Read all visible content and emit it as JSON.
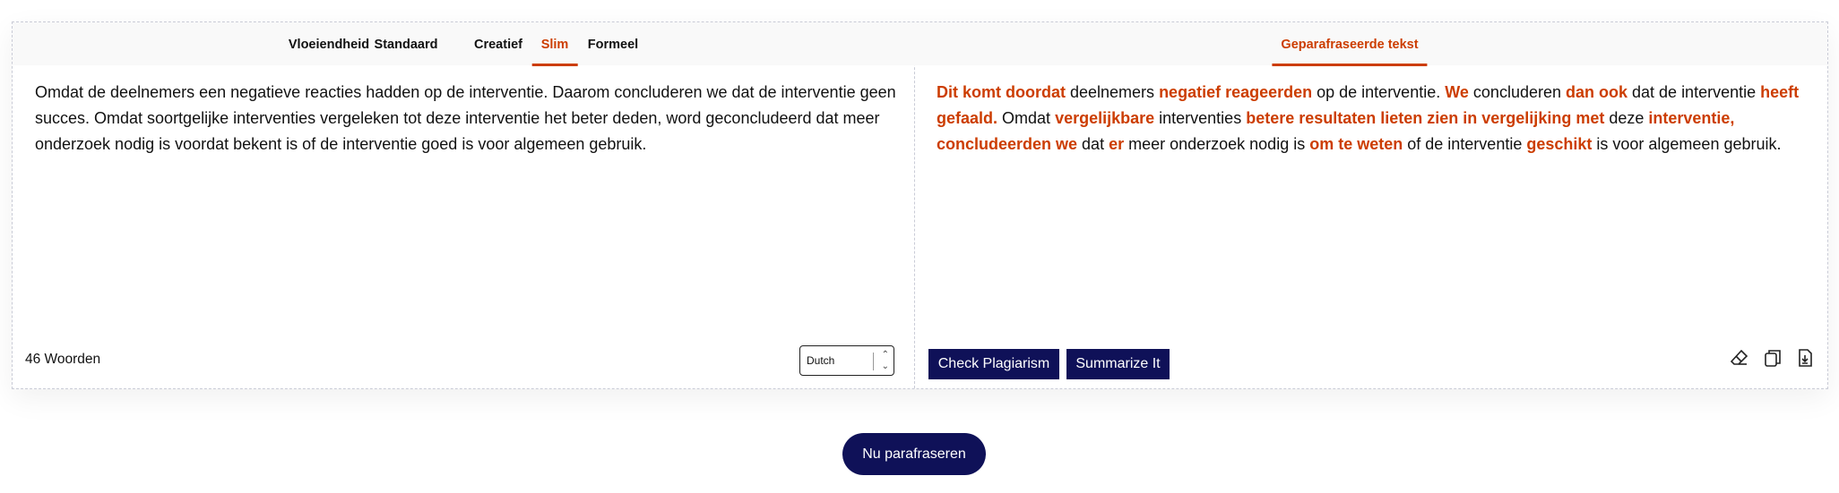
{
  "input_panel": {
    "modes": [
      {
        "label": "Vloeiendheid",
        "active": false
      },
      {
        "label": "Standaard",
        "active": false
      },
      {
        "label": "Creatief",
        "active": false
      },
      {
        "label": "Slim",
        "active": true
      },
      {
        "label": "Formeel",
        "active": false
      }
    ],
    "text": "Omdat de deelnemers een negatieve reacties hadden op de interventie. Daarom concluderen we dat de interventie geen succes. Omdat soortgelijke interventies vergeleken tot deze interventie het beter deden, word geconcludeerd dat meer onderzoek nodig is voordat bekent is of de interventie goed is voor algemeen gebruik.",
    "word_count": "46 Woorden",
    "language": "Dutch"
  },
  "output_panel": {
    "tab_label": "Geparafraseerde tekst",
    "segments": [
      {
        "t": "Dit komt doordat",
        "changed": true
      },
      {
        "t": " deelnemers ",
        "changed": false
      },
      {
        "t": "negatief reageerden",
        "changed": true
      },
      {
        "t": " op de interventie. ",
        "changed": false
      },
      {
        "t": "We",
        "changed": true
      },
      {
        "t": " concluderen ",
        "changed": false
      },
      {
        "t": "dan ook",
        "changed": true
      },
      {
        "t": " dat de interventie ",
        "changed": false
      },
      {
        "t": "heeft gefaald.",
        "changed": true
      },
      {
        "t": " Omdat ",
        "changed": false
      },
      {
        "t": "vergelijkbare",
        "changed": true
      },
      {
        "t": " interventies ",
        "changed": false
      },
      {
        "t": "betere resultaten lieten zien in vergelijking met",
        "changed": true
      },
      {
        "t": " deze ",
        "changed": false
      },
      {
        "t": "interventie, concludeerden we",
        "changed": true
      },
      {
        "t": " dat ",
        "changed": false
      },
      {
        "t": "er",
        "changed": true
      },
      {
        "t": " meer onderzoek nodig is ",
        "changed": false
      },
      {
        "t": "om te weten",
        "changed": true
      },
      {
        "t": " of de interventie ",
        "changed": false
      },
      {
        "t": "geschikt",
        "changed": true
      },
      {
        "t": " is voor algemeen gebruik.",
        "changed": false
      }
    ],
    "check_plagiarism_label": "Check Plagiarism",
    "summarize_label": "Summarize It",
    "icons": [
      "eraser-icon",
      "copy-icon",
      "download-icon"
    ]
  },
  "paraphrase_button_label": "Nu parafraseren",
  "colors": {
    "accent": "#cc3d00",
    "button": "#0f1158"
  }
}
